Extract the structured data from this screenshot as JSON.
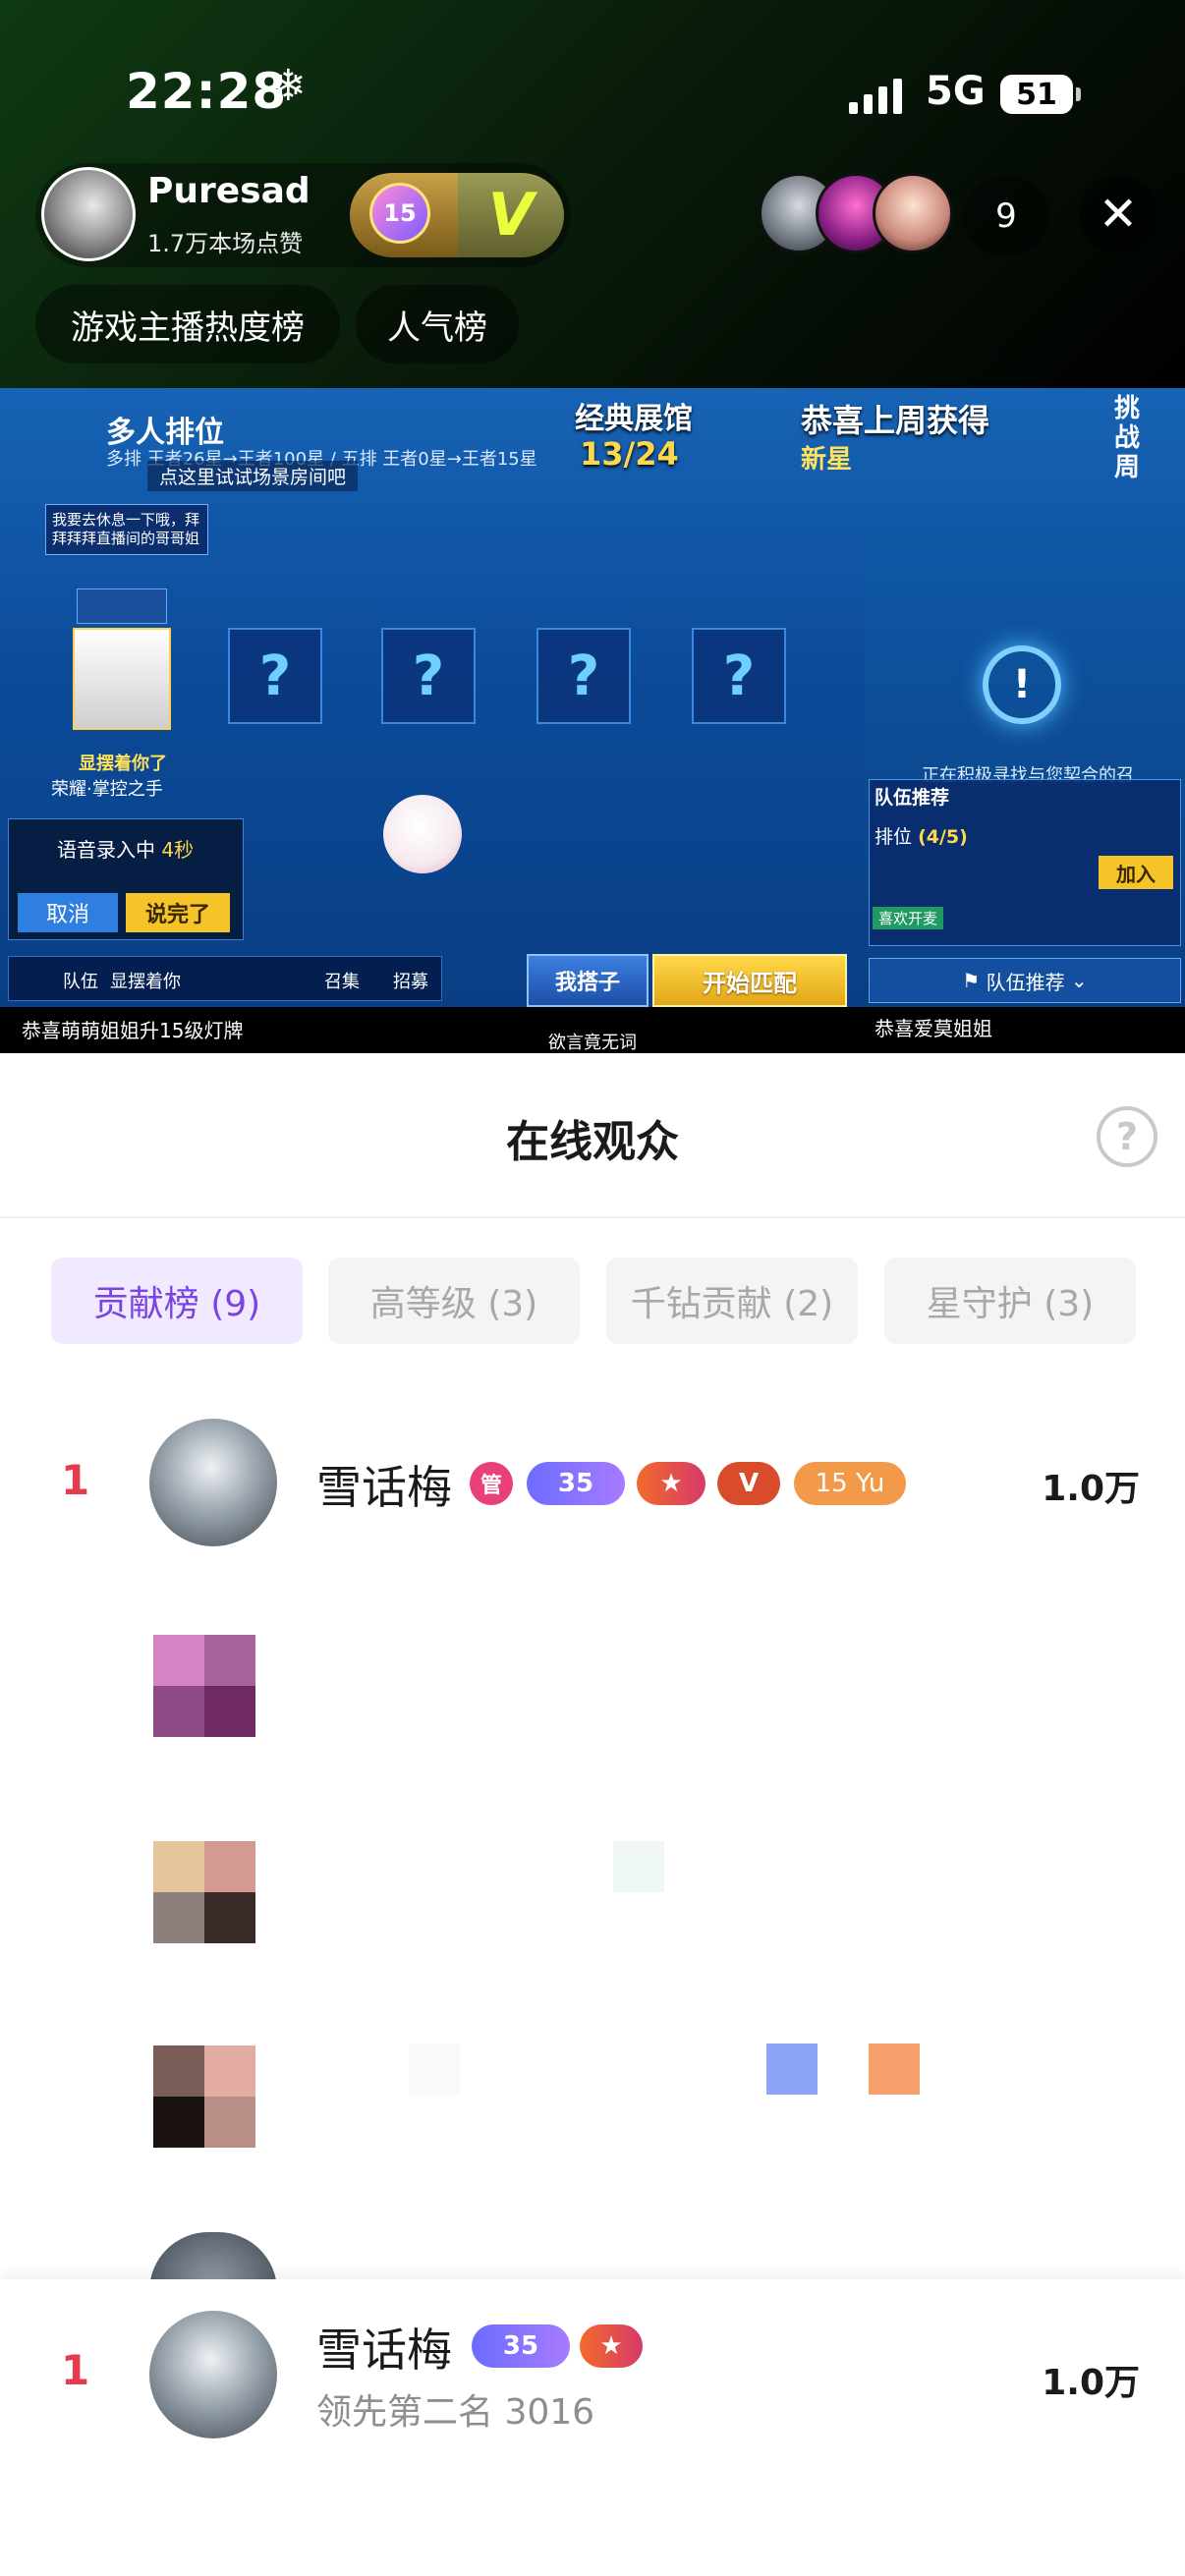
{
  "status_bar": {
    "time": "22:28",
    "weather_icon": "snowflake-icon",
    "network": "5G",
    "battery": "51"
  },
  "host": {
    "name": "Puresad",
    "likes": "1.7万本场点赞",
    "level": "15",
    "v_badge": "V"
  },
  "viewers": {
    "count": "9"
  },
  "chips": {
    "hot_rank": "游戏主播热度榜",
    "popularity": "人气榜"
  },
  "stream": {
    "game_title": "多人排位",
    "game_sub": "多排 王者26星→王者100星 / 五排 王者0星→王者15星",
    "hint": "点这里试试场景房间吧",
    "overlay_title": "经典展馆",
    "overlay_count": "13/24",
    "congrats": "恭喜上周获得",
    "congrats_sub": "新星",
    "challenge": "挑战周",
    "bubble": "我要去休息一下哦，拜拜拜拜直播间的哥哥姐",
    "hero_name": "显摆着你了",
    "hero_rank": "荣耀·掌控之手",
    "slot_mark": "?",
    "voice_title": "语音录入中",
    "voice_time": "4秒",
    "voice_cancel": "取消",
    "voice_done": "说完了",
    "bottom_items": [
      "队伍",
      "显摆着你",
      "召集",
      "招募"
    ],
    "btn_partner": "我搭子",
    "btn_match": "开始匹配",
    "searching": "正在积极寻找与您契合的召",
    "team_title": "队伍推荐",
    "team_rank_label": "排位",
    "team_rank_value": "(4/5)",
    "team_join": "加入",
    "team_tag": "喜欢开麦",
    "team_rec": "队伍推荐",
    "caption_left": "恭喜萌萌姐姐升15级灯牌",
    "caption_mid": "欲言竟无词",
    "caption_right": "恭喜爱莫姐姐"
  },
  "sheet": {
    "title": "在线观众",
    "help_icon": "?",
    "tabs": [
      {
        "label": "贡献榜 (9)",
        "active": true
      },
      {
        "label": "高等级 (3)",
        "active": false
      },
      {
        "label": "千钻贡献 (2)",
        "active": false
      },
      {
        "label": "星守护 (3)",
        "active": false
      }
    ]
  },
  "list": {
    "first": {
      "rank": "1",
      "name": "雪话梅",
      "score": "1.0万",
      "badges": {
        "admin": "管",
        "level": "35",
        "v": "V",
        "fan": "15 Yu"
      }
    }
  },
  "footer": {
    "rank": "1",
    "name": "雪话梅",
    "level": "35",
    "lead_text": "领先第二名 3016",
    "score": "1.0万"
  },
  "colors": {
    "accent": "#7b43e3",
    "accent_bg": "#f1eafe",
    "rank_red": "#e63b4f",
    "admin_pink": "#e93f7a"
  }
}
